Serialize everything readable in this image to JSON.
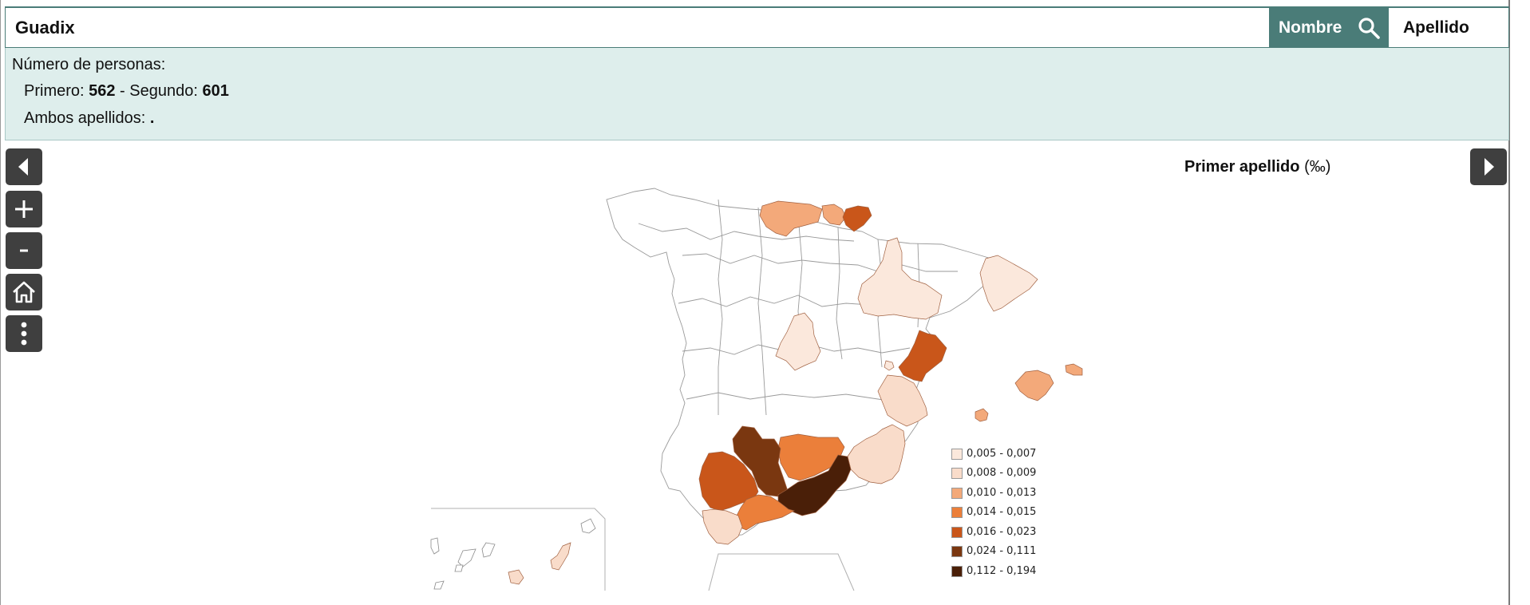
{
  "search": {
    "value": "Guadix"
  },
  "buttons": {
    "nombre": "Nombre",
    "apellido": "Apellido"
  },
  "info": {
    "title": "Número de personas:",
    "primero_label": "Primero: ",
    "primero_value": "562",
    "separator": " - ",
    "segundo_label": "Segundo: ",
    "segundo_value": "601",
    "ambos_label": "Ambos apellidos: ",
    "ambos_value": "."
  },
  "map": {
    "title_main": "Primer apellido",
    "title_unit": "(‰)",
    "legend": [
      {
        "label": "0,005 - 0,007",
        "color": "#fbe8dc"
      },
      {
        "label": "0,008 - 0,009",
        "color": "#f9dcca"
      },
      {
        "label": "0,010 - 0,013",
        "color": "#f3a97a"
      },
      {
        "label": "0,014 - 0,015",
        "color": "#eb7f3a"
      },
      {
        "label": "0,016 - 0,023",
        "color": "#c9561a"
      },
      {
        "label": "0,024 - 0,111",
        "color": "#7a3710"
      },
      {
        "label": "0,112 - 0,194",
        "color": "#4a1f08"
      }
    ]
  },
  "controls": {
    "prev": "chevron-left-icon",
    "zoom_in": "plus-icon",
    "zoom_out": "minus-icon",
    "home": "home-icon",
    "more": "more-vertical-icon",
    "next": "chevron-right-icon"
  }
}
